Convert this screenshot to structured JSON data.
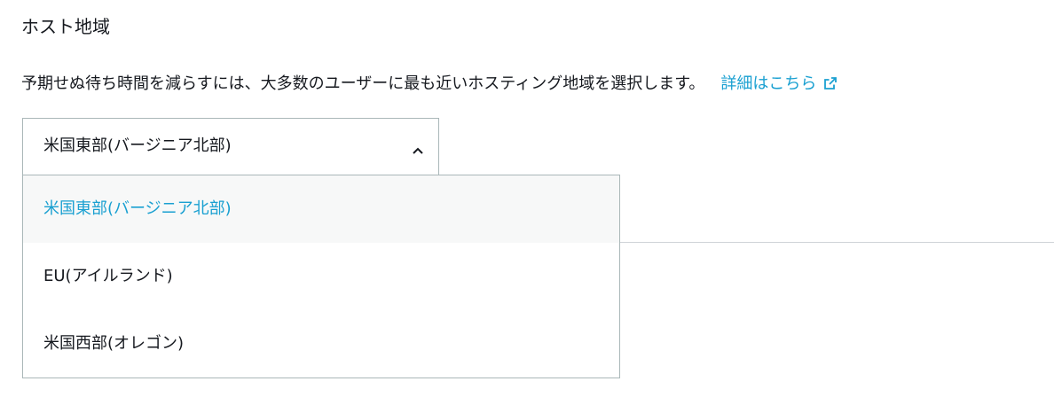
{
  "section": {
    "title": "ホスト地域",
    "description": "予期せぬ待ち時間を減らすには、大多数のユーザーに最も近いホスティング地域を選択します。",
    "learn_more": "詳細はこちら"
  },
  "region_select": {
    "selected_value": "米国東部(バージニア北部)",
    "options": [
      {
        "label": "米国東部(バージニア北部)",
        "selected": true
      },
      {
        "label": "EU(アイルランド)",
        "selected": false
      },
      {
        "label": "米国西部(オレゴン)",
        "selected": false
      }
    ]
  },
  "icons": {
    "learn_more": "external-link-icon",
    "select": "chevron-up-icon"
  },
  "colors": {
    "link": "#1aa0d1",
    "selected_option_bg": "#f7f8f8",
    "border": "#aab7b8"
  }
}
